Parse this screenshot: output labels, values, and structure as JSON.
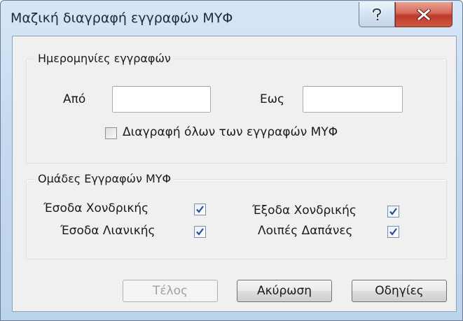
{
  "window": {
    "title": "Μαζική διαγραφή εγγραφών ΜΥΦ",
    "help_icon": "question-mark-icon",
    "close_icon": "close-x-icon"
  },
  "dates_group": {
    "legend": "Ημερομηνίες εγγραφών",
    "from_label": "Από",
    "from_value": "",
    "to_label": "Εως",
    "to_value": "",
    "delete_all_label": "Διαγραφή όλων των εγγραφών ΜΥΦ",
    "delete_all_checked": false
  },
  "groups_group": {
    "legend": "Ομάδες Εγγραφών ΜΥΦ",
    "items": [
      {
        "label": "Έσοδα Χονδρικής",
        "checked": true
      },
      {
        "label": "Έξοδα Χονδρικής",
        "checked": true
      },
      {
        "label": "Έσοδα Λιανικής",
        "checked": true
      },
      {
        "label": "Λοιπές Δαπάνες",
        "checked": true
      }
    ]
  },
  "buttons": {
    "finish": "Τέλος",
    "cancel": "Ακύρωση",
    "help": "Οδηγίες"
  },
  "colors": {
    "title_bar": "#c6daf0",
    "close_button": "#c0392b",
    "client_bg": "#f0f0f0"
  }
}
